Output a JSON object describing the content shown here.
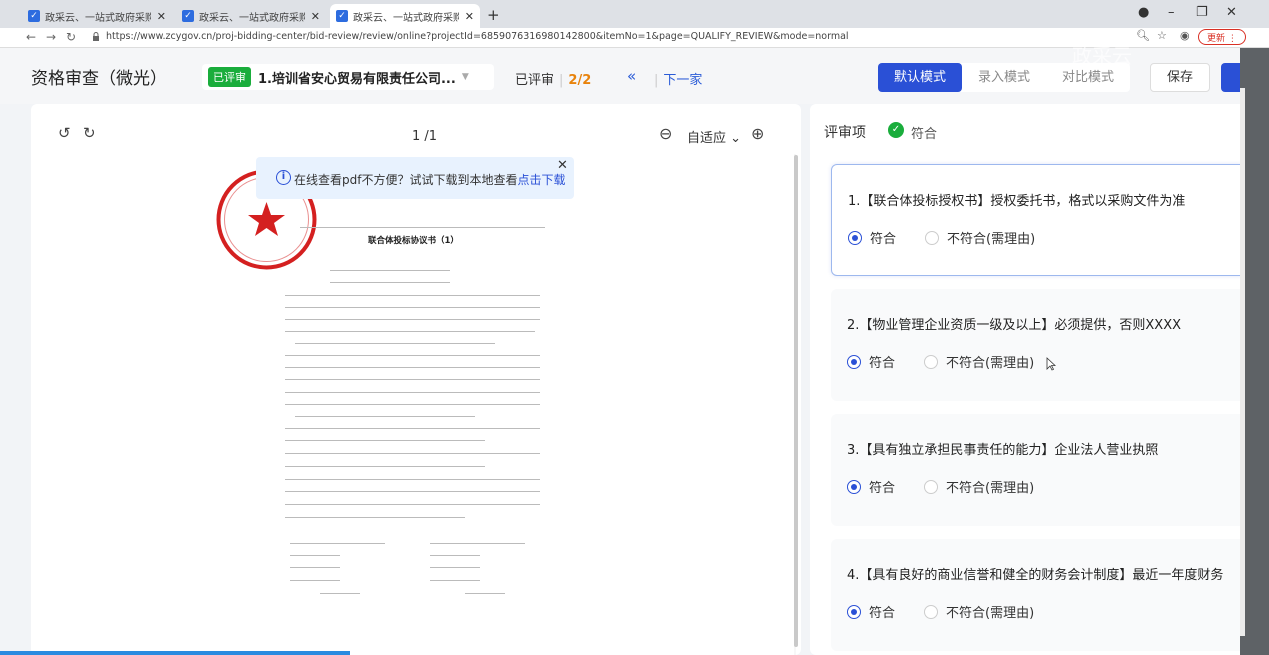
{
  "browser": {
    "tabs": [
      {
        "title": "政采云、一站式政府采购云平台·"
      },
      {
        "title": "政采云、一站式政府采购云平台·"
      },
      {
        "title": "政采云、一站式政府采购云平台·"
      }
    ],
    "new_tab": "+",
    "url": "https://www.zcygov.cn/proj-bidding-center/bid-review/review/online?projectId=6859076316980142800&itemNo=1&page=QUALIFY_REVIEW&mode=normal",
    "update_label": "更新",
    "watermark": "政采云"
  },
  "header": {
    "title": "资格审查（微光）",
    "bidder_tag": "已评审",
    "bidder_name": "1.培训省安心贸易有限责任公司...",
    "reviewed_label": "已评审",
    "reviewed_count": "2/2",
    "prev_icon": "«",
    "next_label": "下一家",
    "modes": [
      "默认模式",
      "录入模式",
      "对比模式"
    ],
    "save_label": "保存"
  },
  "pdf": {
    "page_indicator": "1 /1",
    "zoom_mode": "自适应",
    "banner_text": "在线查看pdf不方便？试试下载到本地查看",
    "banner_link": "点击下载",
    "doc_title": "联合体投标协议书（1）"
  },
  "review": {
    "heading": "评审项",
    "status": "符合",
    "items": [
      {
        "title": "1.【联合体投标授权书】授权委托书，格式以采购文件为准",
        "pass": "符合",
        "fail": "不符合(需理由)",
        "selected": "pass"
      },
      {
        "title": "2.【物业管理企业资质一级及以上】必须提供，否则XXXX",
        "pass": "符合",
        "fail": "不符合(需理由)",
        "selected": "pass"
      },
      {
        "title": "3.【具有独立承担民事责任的能力】企业法人营业执照",
        "pass": "符合",
        "fail": "不符合(需理由)",
        "selected": "pass"
      },
      {
        "title": "4.【具有良好的商业信誉和健全的财务会计制度】最近一年度财务",
        "pass": "符合",
        "fail": "不符合(需理由)",
        "selected": "pass"
      }
    ]
  },
  "colors": {
    "accent": "#2a50d6",
    "success": "#1aad3c",
    "warning": "#e8830c",
    "stamp": "#d42020"
  }
}
